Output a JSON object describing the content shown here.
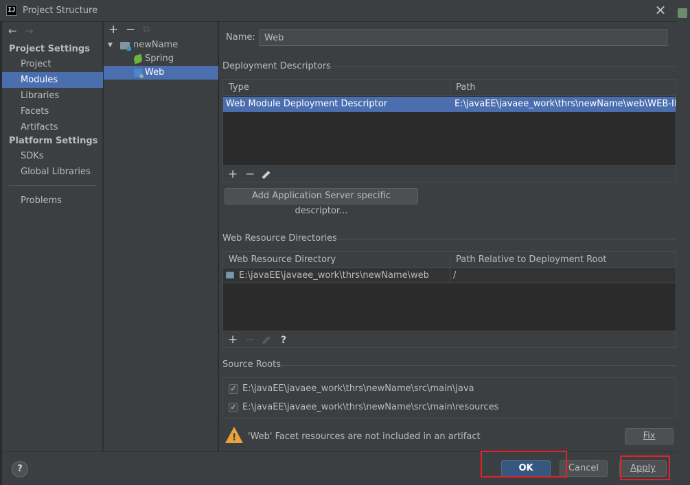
{
  "window": {
    "title": "Project Structure",
    "app_icon_text": "IJ",
    "close_glyph": "✕"
  },
  "nav": {
    "back_glyph": "←",
    "forward_glyph": "→",
    "project_settings_header": "Project Settings",
    "platform_settings_header": "Platform Settings",
    "items": {
      "project": "Project",
      "modules": "Modules",
      "libraries": "Libraries",
      "facets": "Facets",
      "artifacts": "Artifacts",
      "sdks": "SDKs",
      "global_libraries": "Global Libraries",
      "problems": "Problems"
    },
    "selected": "Modules"
  },
  "tree": {
    "add_glyph": "+",
    "remove_glyph": "−",
    "copy_glyph": "⧉",
    "root": "newName",
    "children": [
      "Spring",
      "Web"
    ],
    "selected": "Web"
  },
  "facet": {
    "name_label": "Name:",
    "name_value": "Web",
    "deployment": {
      "title": "Deployment Descriptors",
      "columns": [
        "Type",
        "Path"
      ],
      "rows": [
        {
          "type": "Web Module Deployment Descriptor",
          "path": "E:\\javaEE\\javaee_work\\thrs\\newName\\web\\WEB-INF\\web.xml"
        }
      ],
      "add_server_button": "Add Application Server specific descriptor..."
    },
    "web_resources": {
      "title": "Web Resource Directories",
      "columns": [
        "Web Resource Directory",
        "Path Relative to Deployment Root"
      ],
      "rows": [
        {
          "directory": "E:\\javaEE\\javaee_work\\thrs\\newName\\web",
          "relative": "/"
        }
      ],
      "help_glyph": "?"
    },
    "source_roots": {
      "title": "Source Roots",
      "items": [
        {
          "path": "E:\\javaEE\\javaee_work\\thrs\\newName\\src\\main\\java",
          "checked": true
        },
        {
          "path": "E:\\javaEE\\javaee_work\\thrs\\newName\\src\\main\\resources",
          "checked": true
        }
      ]
    },
    "warning": {
      "text": "'Web' Facet resources are not included in an artifact",
      "fix_button": "Fix"
    }
  },
  "footer": {
    "help_glyph": "?",
    "ok": "OK",
    "cancel": "Cancel",
    "apply": "Apply"
  },
  "colors": {
    "selection": "#4b6eaf",
    "default_button": "#365880",
    "highlight_box": "#e8202a",
    "warning": "#e8a33d"
  }
}
